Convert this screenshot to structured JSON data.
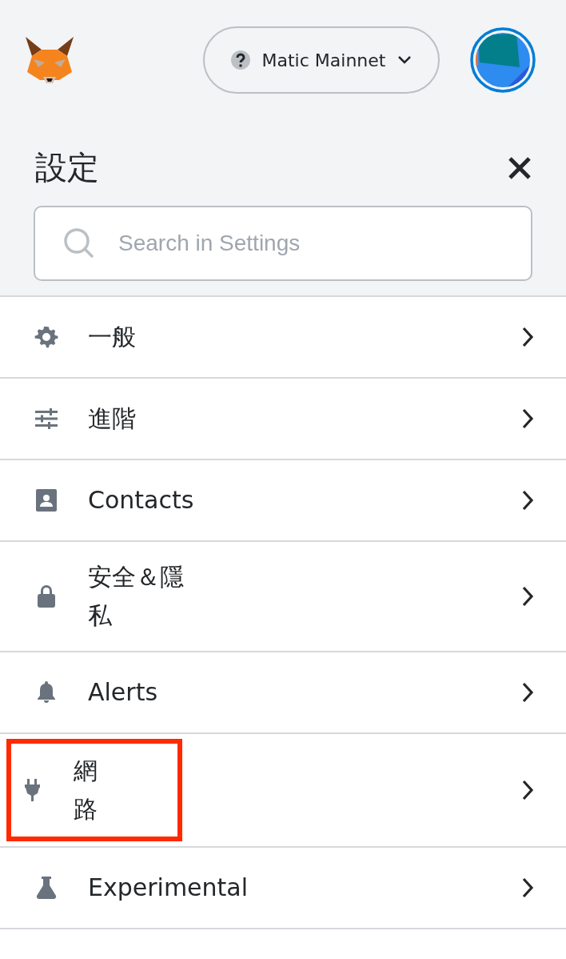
{
  "header": {
    "network": {
      "name": "Matic Mainnet"
    }
  },
  "settings": {
    "title": "設定",
    "search": {
      "placeholder": "Search in Settings"
    },
    "items": [
      {
        "kind": "gear",
        "label": "一般",
        "highlighted": false
      },
      {
        "kind": "sliders",
        "label": "進階",
        "highlighted": false
      },
      {
        "kind": "contacts",
        "label": "Contacts",
        "highlighted": false
      },
      {
        "kind": "lock",
        "label": "安全＆隱私",
        "highlighted": false
      },
      {
        "kind": "bell",
        "label": "Alerts",
        "highlighted": false
      },
      {
        "kind": "plug",
        "label": "網路",
        "highlighted": true
      },
      {
        "kind": "flask",
        "label": "Experimental",
        "highlighted": false
      }
    ]
  }
}
